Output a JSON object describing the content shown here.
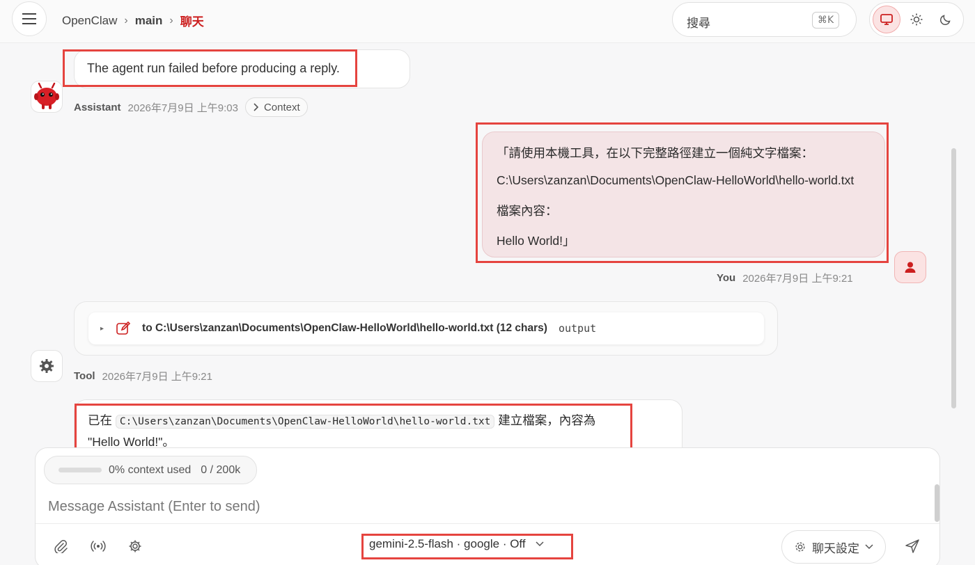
{
  "breadcrumb": {
    "root": "OpenClaw",
    "session": "main",
    "page": "聊天"
  },
  "search": {
    "placeholder": "搜尋",
    "shortcut": "⌘K"
  },
  "theme": {
    "options": [
      "system",
      "light",
      "dark"
    ],
    "active": "system"
  },
  "messages": [
    {
      "role": "assistant",
      "text": "The agent run failed before producing a reply.",
      "author": "Assistant",
      "time": "2026年7月9日 上午9:03",
      "context_label": "Context"
    },
    {
      "role": "user",
      "lines": [
        "「請使用本機工具，在以下完整路徑建立一個純文字檔案：",
        "C:\\Users\\zanzan\\Documents\\OpenClaw-HelloWorld\\hello-world.txt",
        "檔案內容：",
        "Hello World!」"
      ],
      "author": "You",
      "time": "2026年7月9日 上午9:21"
    },
    {
      "role": "tool",
      "summary": "to C:\\Users\\zanzan\\Documents\\OpenClaw-HelloWorld\\hello-world.txt (12 chars)",
      "output_label": "output",
      "author": "Tool",
      "time": "2026年7月9日 上午9:21"
    },
    {
      "role": "assistant",
      "prefix": "已在",
      "code": "C:\\Users\\zanzan\\Documents\\OpenClaw-HelloWorld\\hello-world.txt",
      "suffix": "建立檔案，內容為",
      "line2": "\"Hello World!\"。"
    }
  ],
  "composer": {
    "context_used": "0% context used",
    "context_tokens": "0 / 200k",
    "context_fraction": 0,
    "placeholder": "Message Assistant (Enter to send)",
    "model": "gemini-2.5-flash · google · Off",
    "settings_label": "聊天設定"
  },
  "colors": {
    "accent": "#cc1f1f",
    "highlight": "#e5443f",
    "user_bubble": "#f4e4e6"
  }
}
